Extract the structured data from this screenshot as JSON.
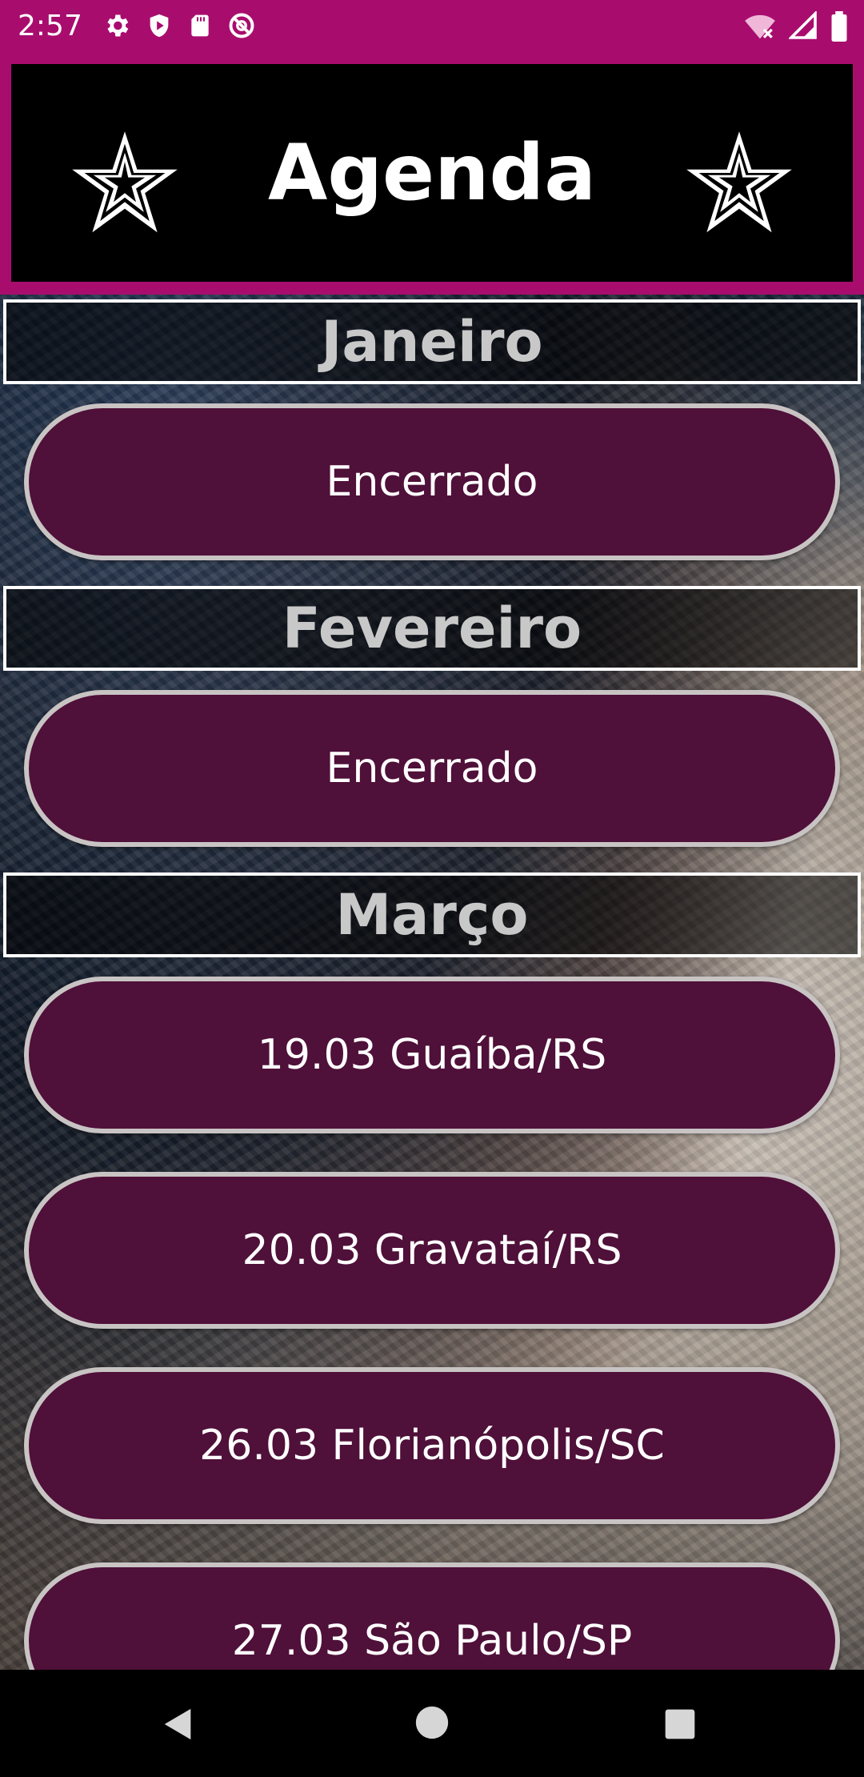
{
  "status_bar": {
    "time": "2:57",
    "left_icons": [
      "gear-icon",
      "shield-icon",
      "sd-card-icon",
      "sync-disabled-icon"
    ],
    "right_icons": [
      "wifi-off-icon",
      "signal-icon",
      "battery-icon"
    ]
  },
  "header": {
    "title": "Agenda",
    "left_icon": "star-icon",
    "right_icon": "star-icon",
    "colors": {
      "frame": "#a80d6e",
      "background": "#000000",
      "title": "#ffffff"
    }
  },
  "months": [
    {
      "name": "Janeiro",
      "events": [
        "Encerrado"
      ]
    },
    {
      "name": "Fevereiro",
      "events": [
        "Encerrado"
      ]
    },
    {
      "name": "Março",
      "events": [
        "19.03 Guaíba/RS",
        "20.03 Gravataí/RS",
        "26.03 Florianópolis/SC",
        "27.03 São Paulo/SP"
      ]
    }
  ],
  "colors": {
    "button_fill": "#4f1039",
    "button_border": "#c9c4c4",
    "month_text": "#c8c8c8"
  },
  "nav_bar": {
    "buttons": [
      "back-icon",
      "home-icon",
      "recent-apps-icon"
    ]
  }
}
